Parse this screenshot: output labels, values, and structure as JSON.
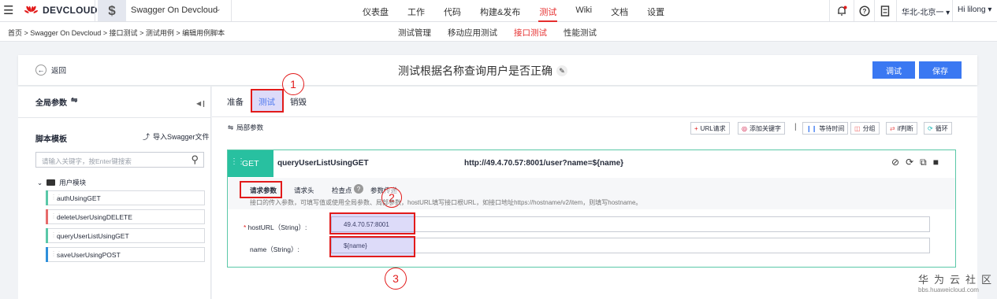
{
  "topbar": {
    "brand": "DEVCLOUD",
    "project": "Swagger On Devcloud",
    "nav": [
      "仪表盘",
      "工作",
      "代码",
      "构建&发布",
      "测试",
      "Wiki",
      "文档",
      "设置"
    ],
    "active_nav_index": 4,
    "region": "华北-北京一",
    "user": "Hi lilong"
  },
  "breadcrumb": "首页 > Swagger On Devcloud > 接口测试 > 测试用例 > 编辑用例脚本",
  "subnav": [
    "测试管理",
    "移动应用测试",
    "接口测试",
    "性能测试"
  ],
  "active_subnav_index": 2,
  "header": {
    "back_label": "返回",
    "title": "测试根据名称查询用户是否正确",
    "debug_label": "调试",
    "save_label": "保存"
  },
  "left": {
    "global_params": "全局参数",
    "script_templates": "脚本模板",
    "import_swagger": "导入Swagger文件",
    "search_placeholder": "请输入关键字，按Enter键搜索",
    "folder": "用户模块",
    "apis": [
      {
        "name": "authUsingGET",
        "color": "#5ac8a8"
      },
      {
        "name": "deleteUserUsingDELETE",
        "color": "#e66b6b"
      },
      {
        "name": "queryUserListUsingGET",
        "color": "#5ac8a8"
      },
      {
        "name": "saveUserUsingPOST",
        "color": "#2e8fdb"
      }
    ]
  },
  "right": {
    "tabs": [
      "准备",
      "测试",
      "销毁"
    ],
    "active_tab_index": 1,
    "local_params": "局部参数",
    "toolbar": [
      "URL请求",
      "添加关键字",
      "等待时间",
      "分组",
      "if判断",
      "循环"
    ],
    "api": {
      "method": "GET",
      "name": "queryUserListUsingGET",
      "url": "http://49.4.70.57:8001/user?name=${name}",
      "subtabs": [
        "请求参数",
        "请求头",
        "检查点",
        "参数传递"
      ],
      "hint": "接口的传入参数，可填写值或使用全局参数、局部参数，hostURL填写接口根URL，如接口地址https://hostname/v2/item，则填写hostname。",
      "fields": [
        {
          "label": "hostURL（String）:",
          "required": true,
          "value": "49.4.70.57:8001"
        },
        {
          "label": "name（String）:",
          "required": false,
          "value": "${name}"
        }
      ]
    }
  },
  "annotations": [
    "1",
    "2",
    "3"
  ],
  "watermark": {
    "line1": "华为云社区",
    "line2": "bbs.huaweicloud.com"
  }
}
